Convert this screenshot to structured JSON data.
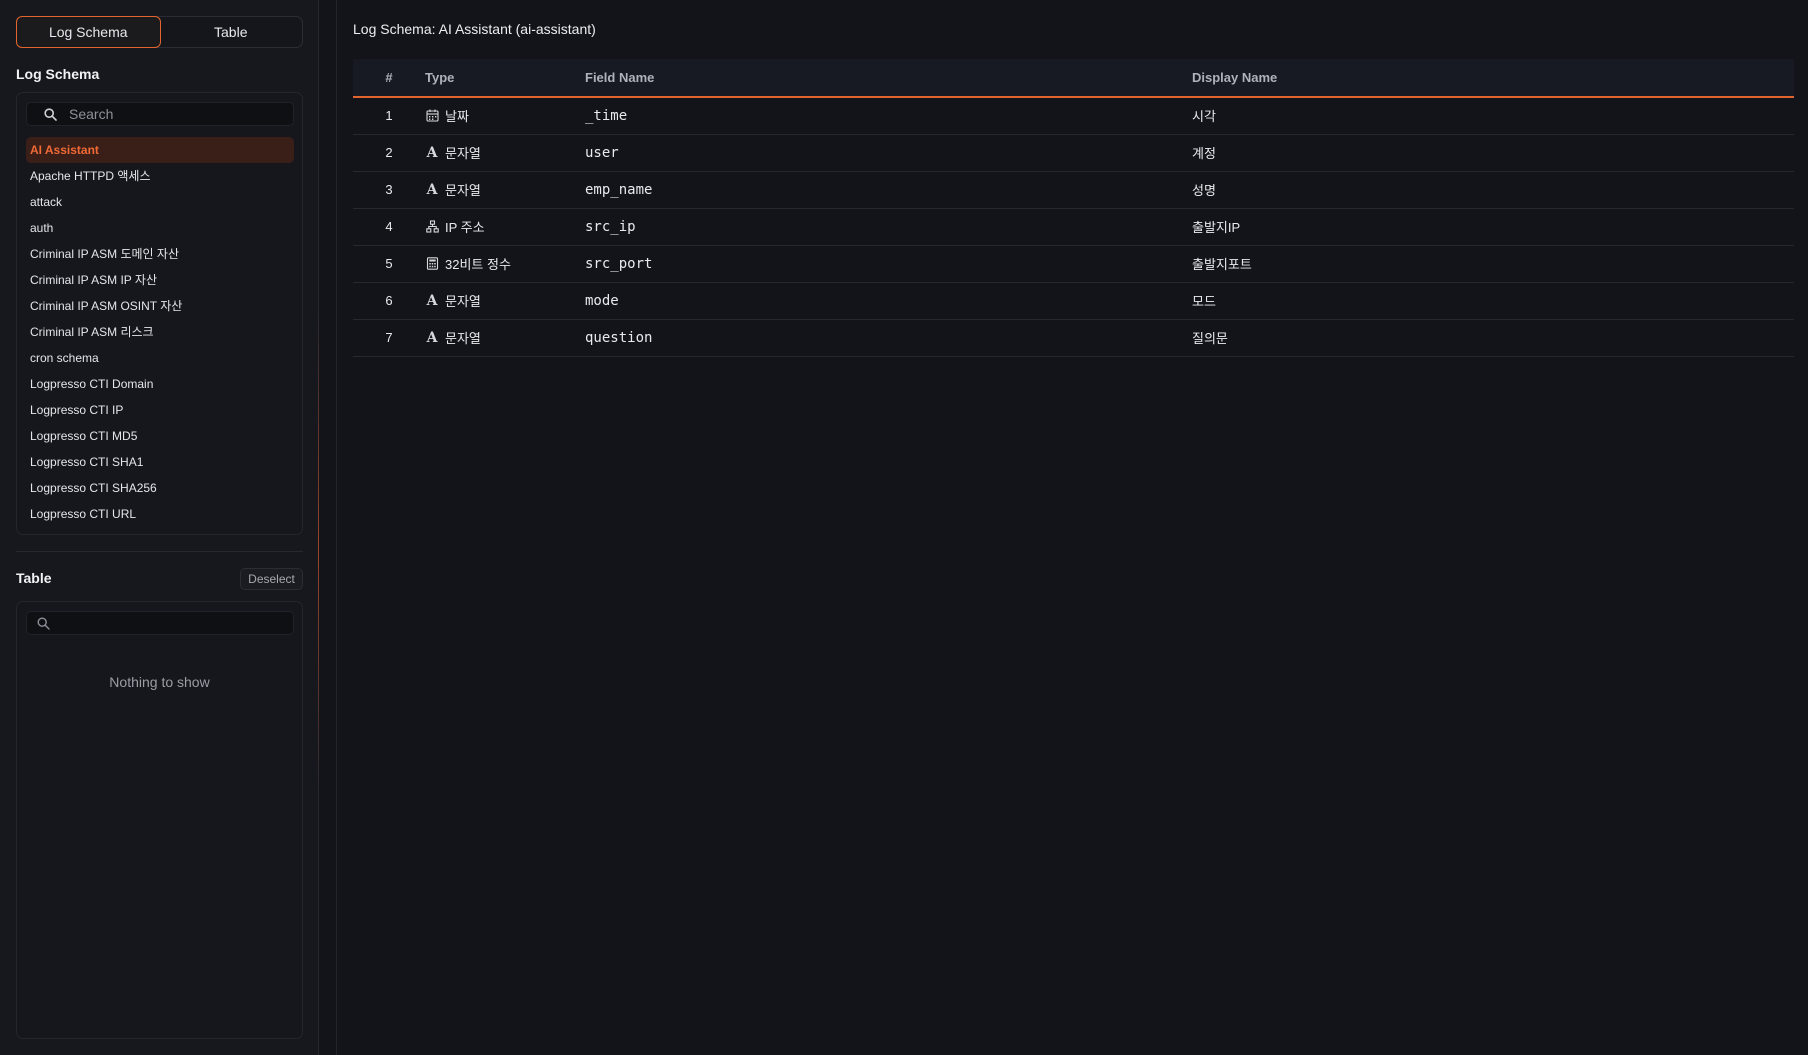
{
  "sidebar": {
    "mode_tabs": [
      {
        "label": "Log Schema",
        "active": true
      },
      {
        "label": "Table",
        "active": false
      }
    ],
    "schema_section": {
      "title": "Log Schema",
      "search_placeholder": "Search",
      "items": [
        {
          "label": "AI Assistant",
          "active": true
        },
        {
          "label": "Apache HTTPD 액세스"
        },
        {
          "label": "attack"
        },
        {
          "label": "auth"
        },
        {
          "label": "Criminal IP ASM 도메인 자산"
        },
        {
          "label": "Criminal IP ASM IP 자산"
        },
        {
          "label": "Criminal IP ASM OSINT 자산"
        },
        {
          "label": "Criminal IP ASM 리스크"
        },
        {
          "label": "cron schema"
        },
        {
          "label": "Logpresso CTI Domain"
        },
        {
          "label": "Logpresso CTI IP"
        },
        {
          "label": "Logpresso CTI MD5"
        },
        {
          "label": "Logpresso CTI SHA1"
        },
        {
          "label": "Logpresso CTI SHA256"
        },
        {
          "label": "Logpresso CTI URL"
        }
      ]
    },
    "table_section": {
      "title": "Table",
      "deselect_label": "Deselect",
      "search_placeholder": "",
      "empty_text": "Nothing to show"
    }
  },
  "main": {
    "title": "Log Schema: AI Assistant (ai-assistant)",
    "columns": {
      "num": "#",
      "type": "Type",
      "field": "Field Name",
      "display": "Display Name"
    },
    "rows": [
      {
        "num": "1",
        "type_icon": "calendar-icon",
        "type": "날짜",
        "field": "_time",
        "display": "시각"
      },
      {
        "num": "2",
        "type_icon": "text-type-icon",
        "type": "문자열",
        "field": "user",
        "display": "계정"
      },
      {
        "num": "3",
        "type_icon": "text-type-icon",
        "type": "문자열",
        "field": "emp_name",
        "display": "성명"
      },
      {
        "num": "4",
        "type_icon": "network-icon",
        "type": "IP 주소",
        "field": "src_ip",
        "display": "출발지IP"
      },
      {
        "num": "5",
        "type_icon": "calculator-icon",
        "type": "32비트 정수",
        "field": "src_port",
        "display": "출발지포트"
      },
      {
        "num": "6",
        "type_icon": "text-type-icon",
        "type": "문자열",
        "field": "mode",
        "display": "모드"
      },
      {
        "num": "7",
        "type_icon": "text-type-icon",
        "type": "문자열",
        "field": "question",
        "display": "질의문"
      }
    ]
  },
  "colors": {
    "accent": "#e2642e",
    "background": "#121419",
    "panel": "#16181e"
  }
}
